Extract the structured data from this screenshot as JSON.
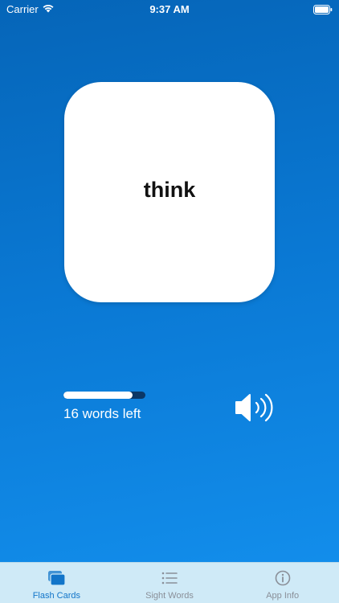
{
  "status_bar": {
    "carrier": "Carrier",
    "time": "9:37 AM"
  },
  "card": {
    "word": "think"
  },
  "progress": {
    "fraction": 0.84,
    "words_left_text": "16 words left"
  },
  "colors": {
    "accent": "#1275c9",
    "inactive": "#8a8f98",
    "tab_bar": "#cfeaf7",
    "progress_track": "#0b3766"
  },
  "tabs": [
    {
      "label": "Flash Cards",
      "icon": "cards-icon",
      "active": true
    },
    {
      "label": "Sight Words",
      "icon": "list-icon",
      "active": false
    },
    {
      "label": "App Info",
      "icon": "info-icon",
      "active": false
    }
  ]
}
